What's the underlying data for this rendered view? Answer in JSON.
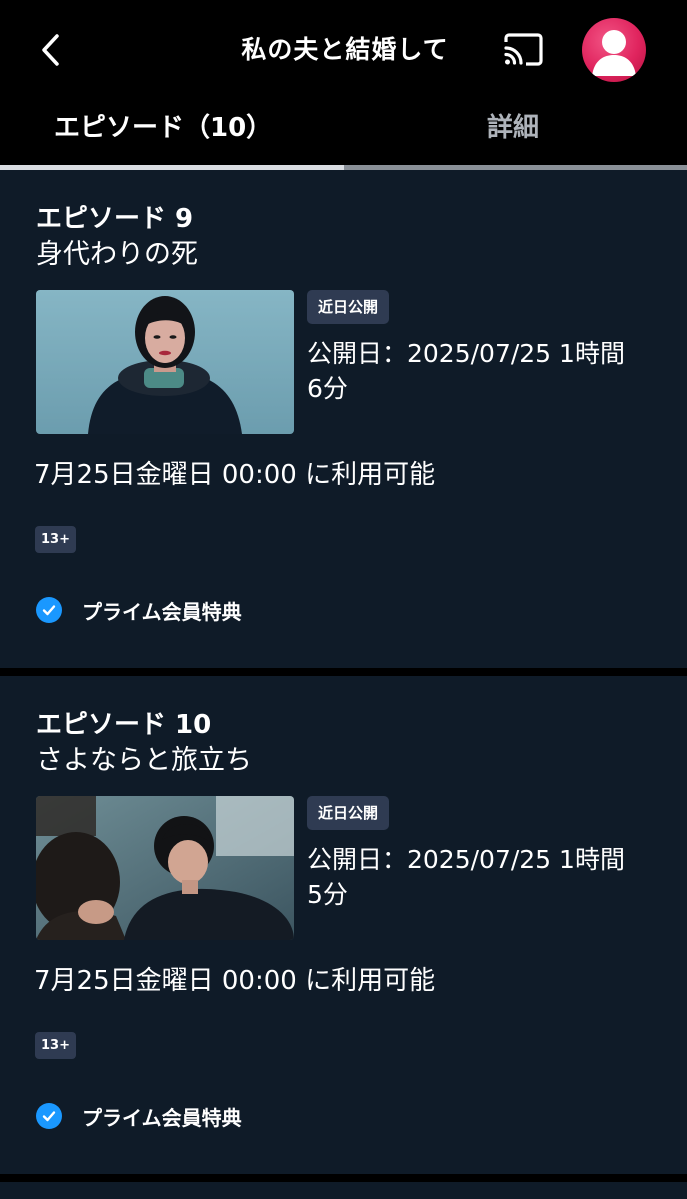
{
  "header": {
    "title": "私の夫と結婚して",
    "back_icon": "chevron-left-icon",
    "cast_icon": "cast-icon",
    "avatar_icon": "user-avatar-icon",
    "avatar_color": "#e0245e"
  },
  "tabs": [
    {
      "label": "エピソード（10）",
      "active": true
    },
    {
      "label": "詳細",
      "active": false
    }
  ],
  "episodes": [
    {
      "number_label": "エピソード 9",
      "title": "身代わりの死",
      "badge": "近日公開",
      "release": "公開日：2025/07/25 1時間 6分",
      "availability": "7月25日金曜日 00:00 に利用可能",
      "rating": "13+",
      "prime_label": "プライム会員特典",
      "thumbnail": "woman-in-snow-thumbnail"
    },
    {
      "number_label": "エピソード 10",
      "title": "さよならと旅立ち",
      "badge": "近日公開",
      "release": "公開日：2025/07/25 1時間 5分",
      "availability": "7月25日金曜日 00:00 に利用可能",
      "rating": "13+",
      "prime_label": "プライム会員特典",
      "thumbnail": "two-people-thumbnail"
    }
  ],
  "colors": {
    "background": "#000000",
    "card": "#0f1b28",
    "badge": "#2f3b52",
    "prime_check": "#1a98ff",
    "inactive_tab": "#aeb3ba"
  }
}
